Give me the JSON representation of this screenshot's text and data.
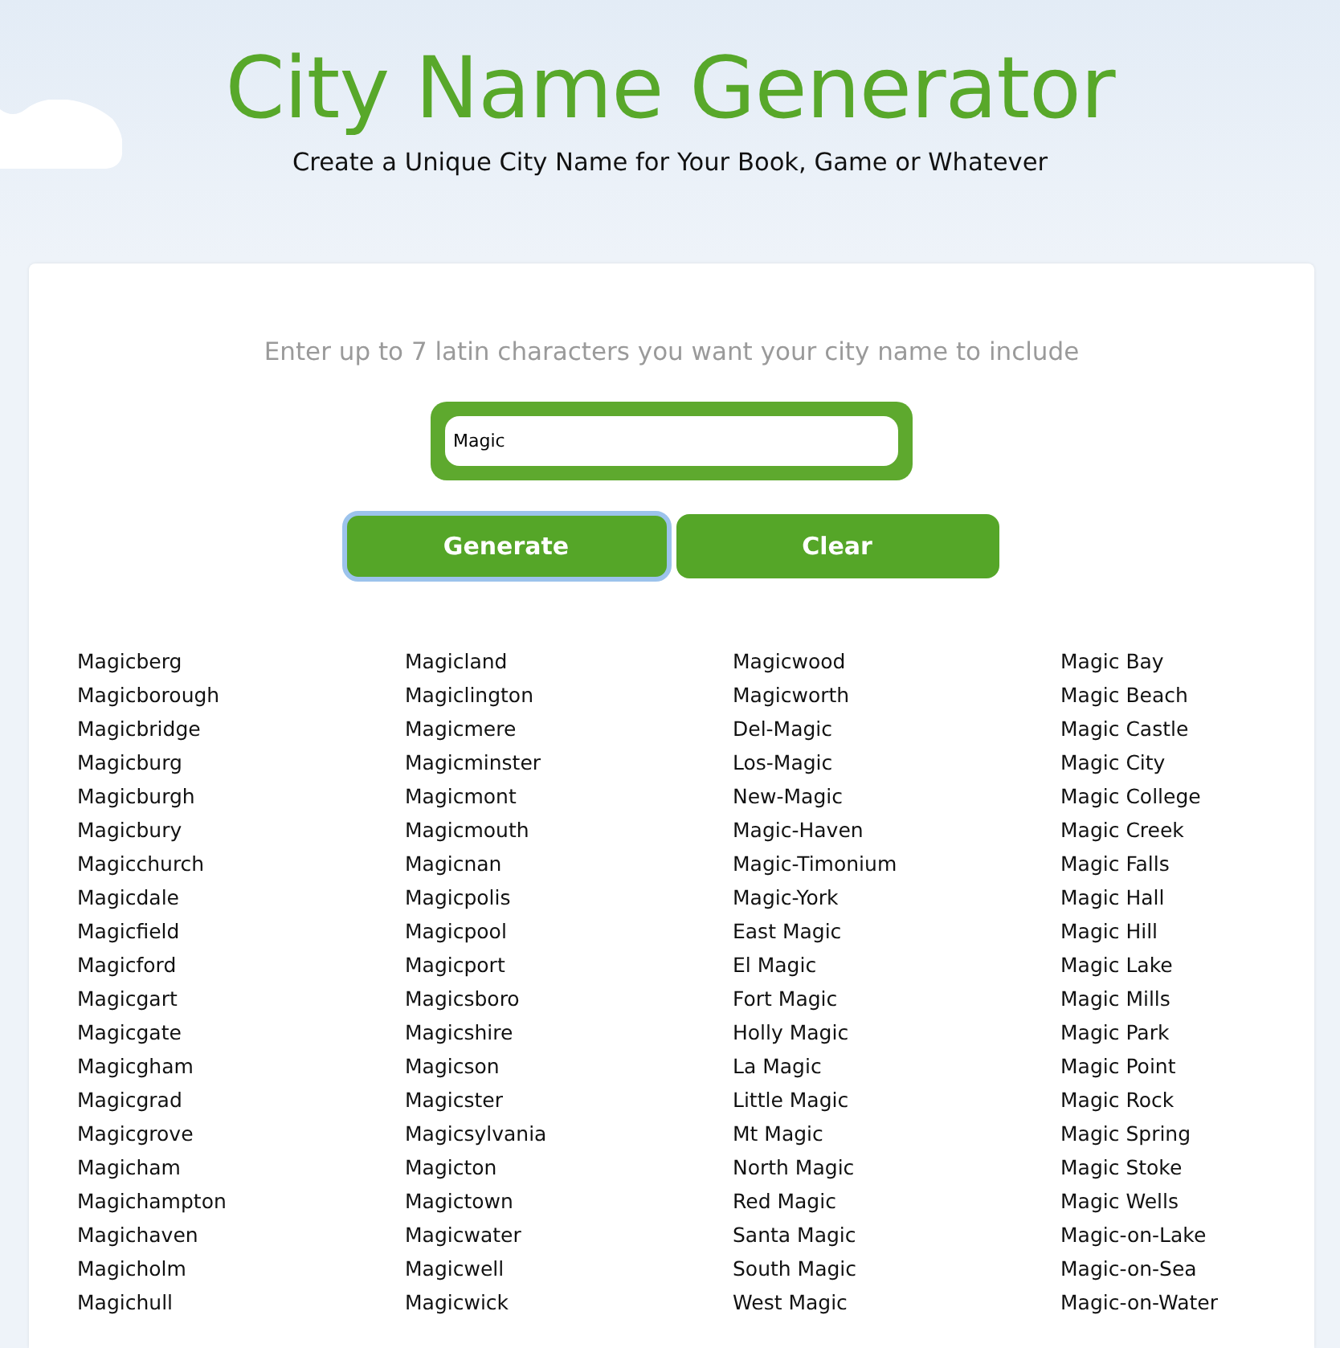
{
  "header": {
    "title": "City Name Generator",
    "subtitle": "Create a Unique City Name for Your Book, Game or Whatever"
  },
  "form": {
    "prompt": "Enter up to 7 latin characters you want your city name to include",
    "input": {
      "value": "Magic"
    },
    "buttons": [
      {
        "label": "Generate",
        "focused": true
      },
      {
        "label": "Clear",
        "focused": false
      }
    ]
  },
  "results": {
    "columns": [
      {
        "names": [
          "Magicberg",
          "Magicborough",
          "Magicbridge",
          "Magicburg",
          "Magicburgh",
          "Magicbury",
          "Magicchurch",
          "Magicdale",
          "Magicfield",
          "Magicford",
          "Magicgart",
          "Magicgate",
          "Magicgham",
          "Magicgrad",
          "Magicgrove",
          "Magicham",
          "Magichampton",
          "Magichaven",
          "Magicholm",
          "Magichull"
        ]
      },
      {
        "names": [
          "Magicland",
          "Magiclington",
          "Magicmere",
          "Magicminster",
          "Magicmont",
          "Magicmouth",
          "Magicnan",
          "Magicpolis",
          "Magicpool",
          "Magicport",
          "Magicsboro",
          "Magicshire",
          "Magicson",
          "Magicster",
          "Magicsylvania",
          "Magicton",
          "Magictown",
          "Magicwater",
          "Magicwell",
          "Magicwick"
        ]
      },
      {
        "names": [
          "Magicwood",
          "Magicworth",
          "Del-Magic",
          "Los-Magic",
          "New-Magic",
          "Magic-Haven",
          "Magic-Timonium",
          "Magic-York",
          "East Magic",
          "El Magic",
          "Fort Magic",
          "Holly Magic",
          "La Magic",
          "Little Magic",
          "Mt Magic",
          "North Magic",
          "Red Magic",
          "Santa Magic",
          "South Magic",
          "West Magic"
        ]
      },
      {
        "names": [
          "Magic Bay",
          "Magic Beach",
          "Magic Castle",
          "Magic City",
          "Magic College",
          "Magic Creek",
          "Magic Falls",
          "Magic Hall",
          "Magic Hill",
          "Magic Lake",
          "Magic Mills",
          "Magic Park",
          "Magic Point",
          "Magic Rock",
          "Magic Spring",
          "Magic Stoke",
          "Magic Wells",
          "Magic-on-Lake",
          "Magic-on-Sea",
          "Magic-on-Water"
        ]
      }
    ]
  }
}
